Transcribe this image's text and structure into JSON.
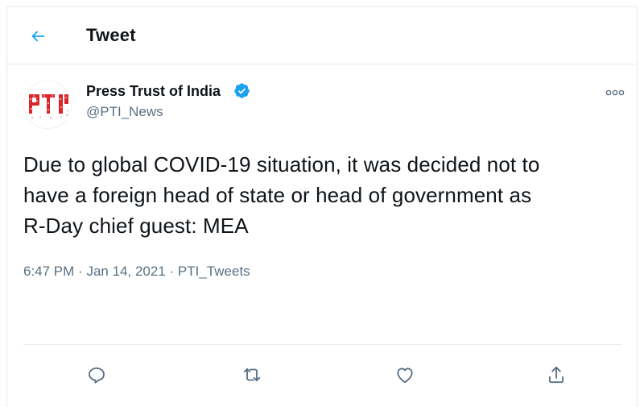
{
  "header": {
    "title": "Tweet"
  },
  "tweet": {
    "author_name": "Press Trust of India",
    "handle": "@PTI_News",
    "avatar_logo_text": "PTI",
    "text_lines": [
      "Due to global COVID-19 situation, it was decided not to",
      "have a foreign head of state or head of government as",
      "R-Day chief guest: MEA"
    ],
    "time": "6:47 PM",
    "date": "Jan 14, 2021",
    "source": "PTI_Tweets",
    "separator": "·"
  },
  "icons": {
    "back": "arrow-left-icon",
    "verified": "verified-badge-icon",
    "more": "more-icon",
    "reply": "reply-icon",
    "retweet": "retweet-icon",
    "like": "like-icon",
    "share": "share-icon"
  },
  "colors": {
    "accent": "#1da1f2",
    "text_primary": "#0f1419",
    "text_secondary": "#5b7083",
    "border": "#e6ecf0",
    "logo_red": "#d9262a"
  }
}
